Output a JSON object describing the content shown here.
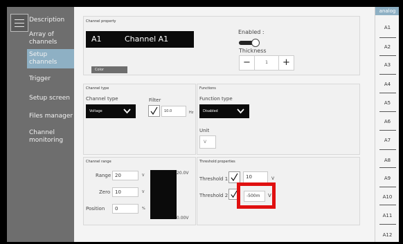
{
  "sidebar": {
    "items": [
      {
        "label": "Description"
      },
      {
        "label": "Array of channels"
      },
      {
        "label": "Setup channels"
      },
      {
        "label": "Trigger"
      },
      {
        "label": "Setup screen"
      },
      {
        "label": "Files manager"
      },
      {
        "label": "Channel monitoring"
      }
    ],
    "active_index": 2
  },
  "channel_property": {
    "title": "Channel property",
    "channel_id": "A1",
    "channel_name": "Channel A1",
    "enabled_label": "Enabled :",
    "enabled": true,
    "thickness_label": "Thickness",
    "thickness_minus": "−",
    "thickness_value": "1",
    "thickness_plus": "+",
    "color_label": "Color"
  },
  "channel_type": {
    "title": "Channel type",
    "type_label": "Channel type",
    "type_value": "Voltage",
    "filter_label": "Filter",
    "filter_checked": true,
    "filter_value": "10.0",
    "filter_unit": "Hz"
  },
  "functions": {
    "title": "Functions",
    "type_label": "Function type",
    "type_value": "Disabled",
    "unit_label": "Unit",
    "unit_value": "V"
  },
  "channel_range": {
    "title": "Channel range",
    "range_label": "Range",
    "range_value": "20",
    "range_unit": "V",
    "zero_label": "Zero",
    "zero_value": "10",
    "zero_unit": "V",
    "position_label": "Position",
    "position_value": "0",
    "position_unit": "%",
    "scale_top": "20.0V",
    "scale_bottom": "0.00V"
  },
  "threshold": {
    "title": "Threshold properties",
    "t1_label": "Threshold 1",
    "t1_checked": true,
    "t1_value": "10",
    "t1_unit": "V",
    "t2_label": "Threshold 2",
    "t2_checked": true,
    "t2_value": "-500m",
    "t2_unit": "V",
    "highlight_color": "#e01010"
  },
  "analog": {
    "header": "analog",
    "items": [
      "A1",
      "A2",
      "A3",
      "A4",
      "A5",
      "A6",
      "A7",
      "A8",
      "A9",
      "A10",
      "A11",
      "A12"
    ]
  },
  "colors": {
    "sidebar_bg": "#6e6e6e",
    "active_bg": "#8eb0c4",
    "dark_box": "#0b0b0b"
  }
}
